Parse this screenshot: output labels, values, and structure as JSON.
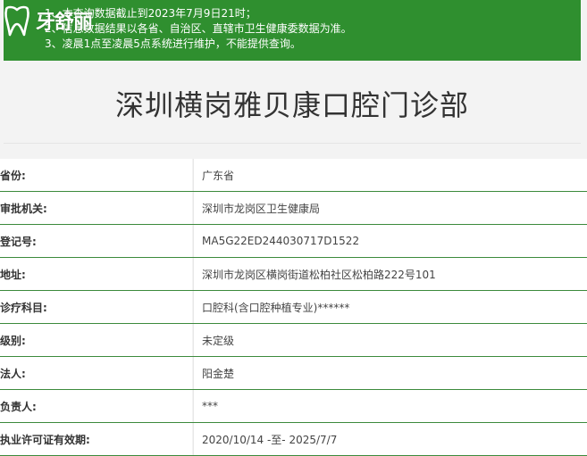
{
  "notice": {
    "lines": [
      "1、本查询数据截止到2023年7月9日21时；",
      "2、信息数据结果以各省、自治区、直辖市卫生健康委数据为准。",
      "3、凌晨1点至凌晨5点系统进行维护，不能提供查询。"
    ]
  },
  "logo": {
    "text": "牙舒丽"
  },
  "page_title": "深圳横岗雅贝康口腔门诊部",
  "fields": [
    {
      "label": "省份:",
      "value": "广东省"
    },
    {
      "label": "审批机关:",
      "value": "深圳市龙岗区卫生健康局"
    },
    {
      "label": "登记号:",
      "value": "MA5G22ED244030717D1522"
    },
    {
      "label": "地址:",
      "value": "深圳市龙岗区横岗街道松柏社区松柏路222号101"
    },
    {
      "label": "诊疗科目:",
      "value": "口腔科(含口腔种植专业)******"
    },
    {
      "label": "级别:",
      "value": "未定级"
    },
    {
      "label": "法人:",
      "value": "阳金楚"
    },
    {
      "label": "负责人:",
      "value": "***"
    },
    {
      "label": "执业许可证有效期:",
      "value": "2020/10/14 -至- 2025/7/7"
    }
  ],
  "colors": {
    "notice_bg": "#2f8f2f",
    "row_border": "#3c8a3c",
    "page_bg": "#f3f3f3"
  }
}
